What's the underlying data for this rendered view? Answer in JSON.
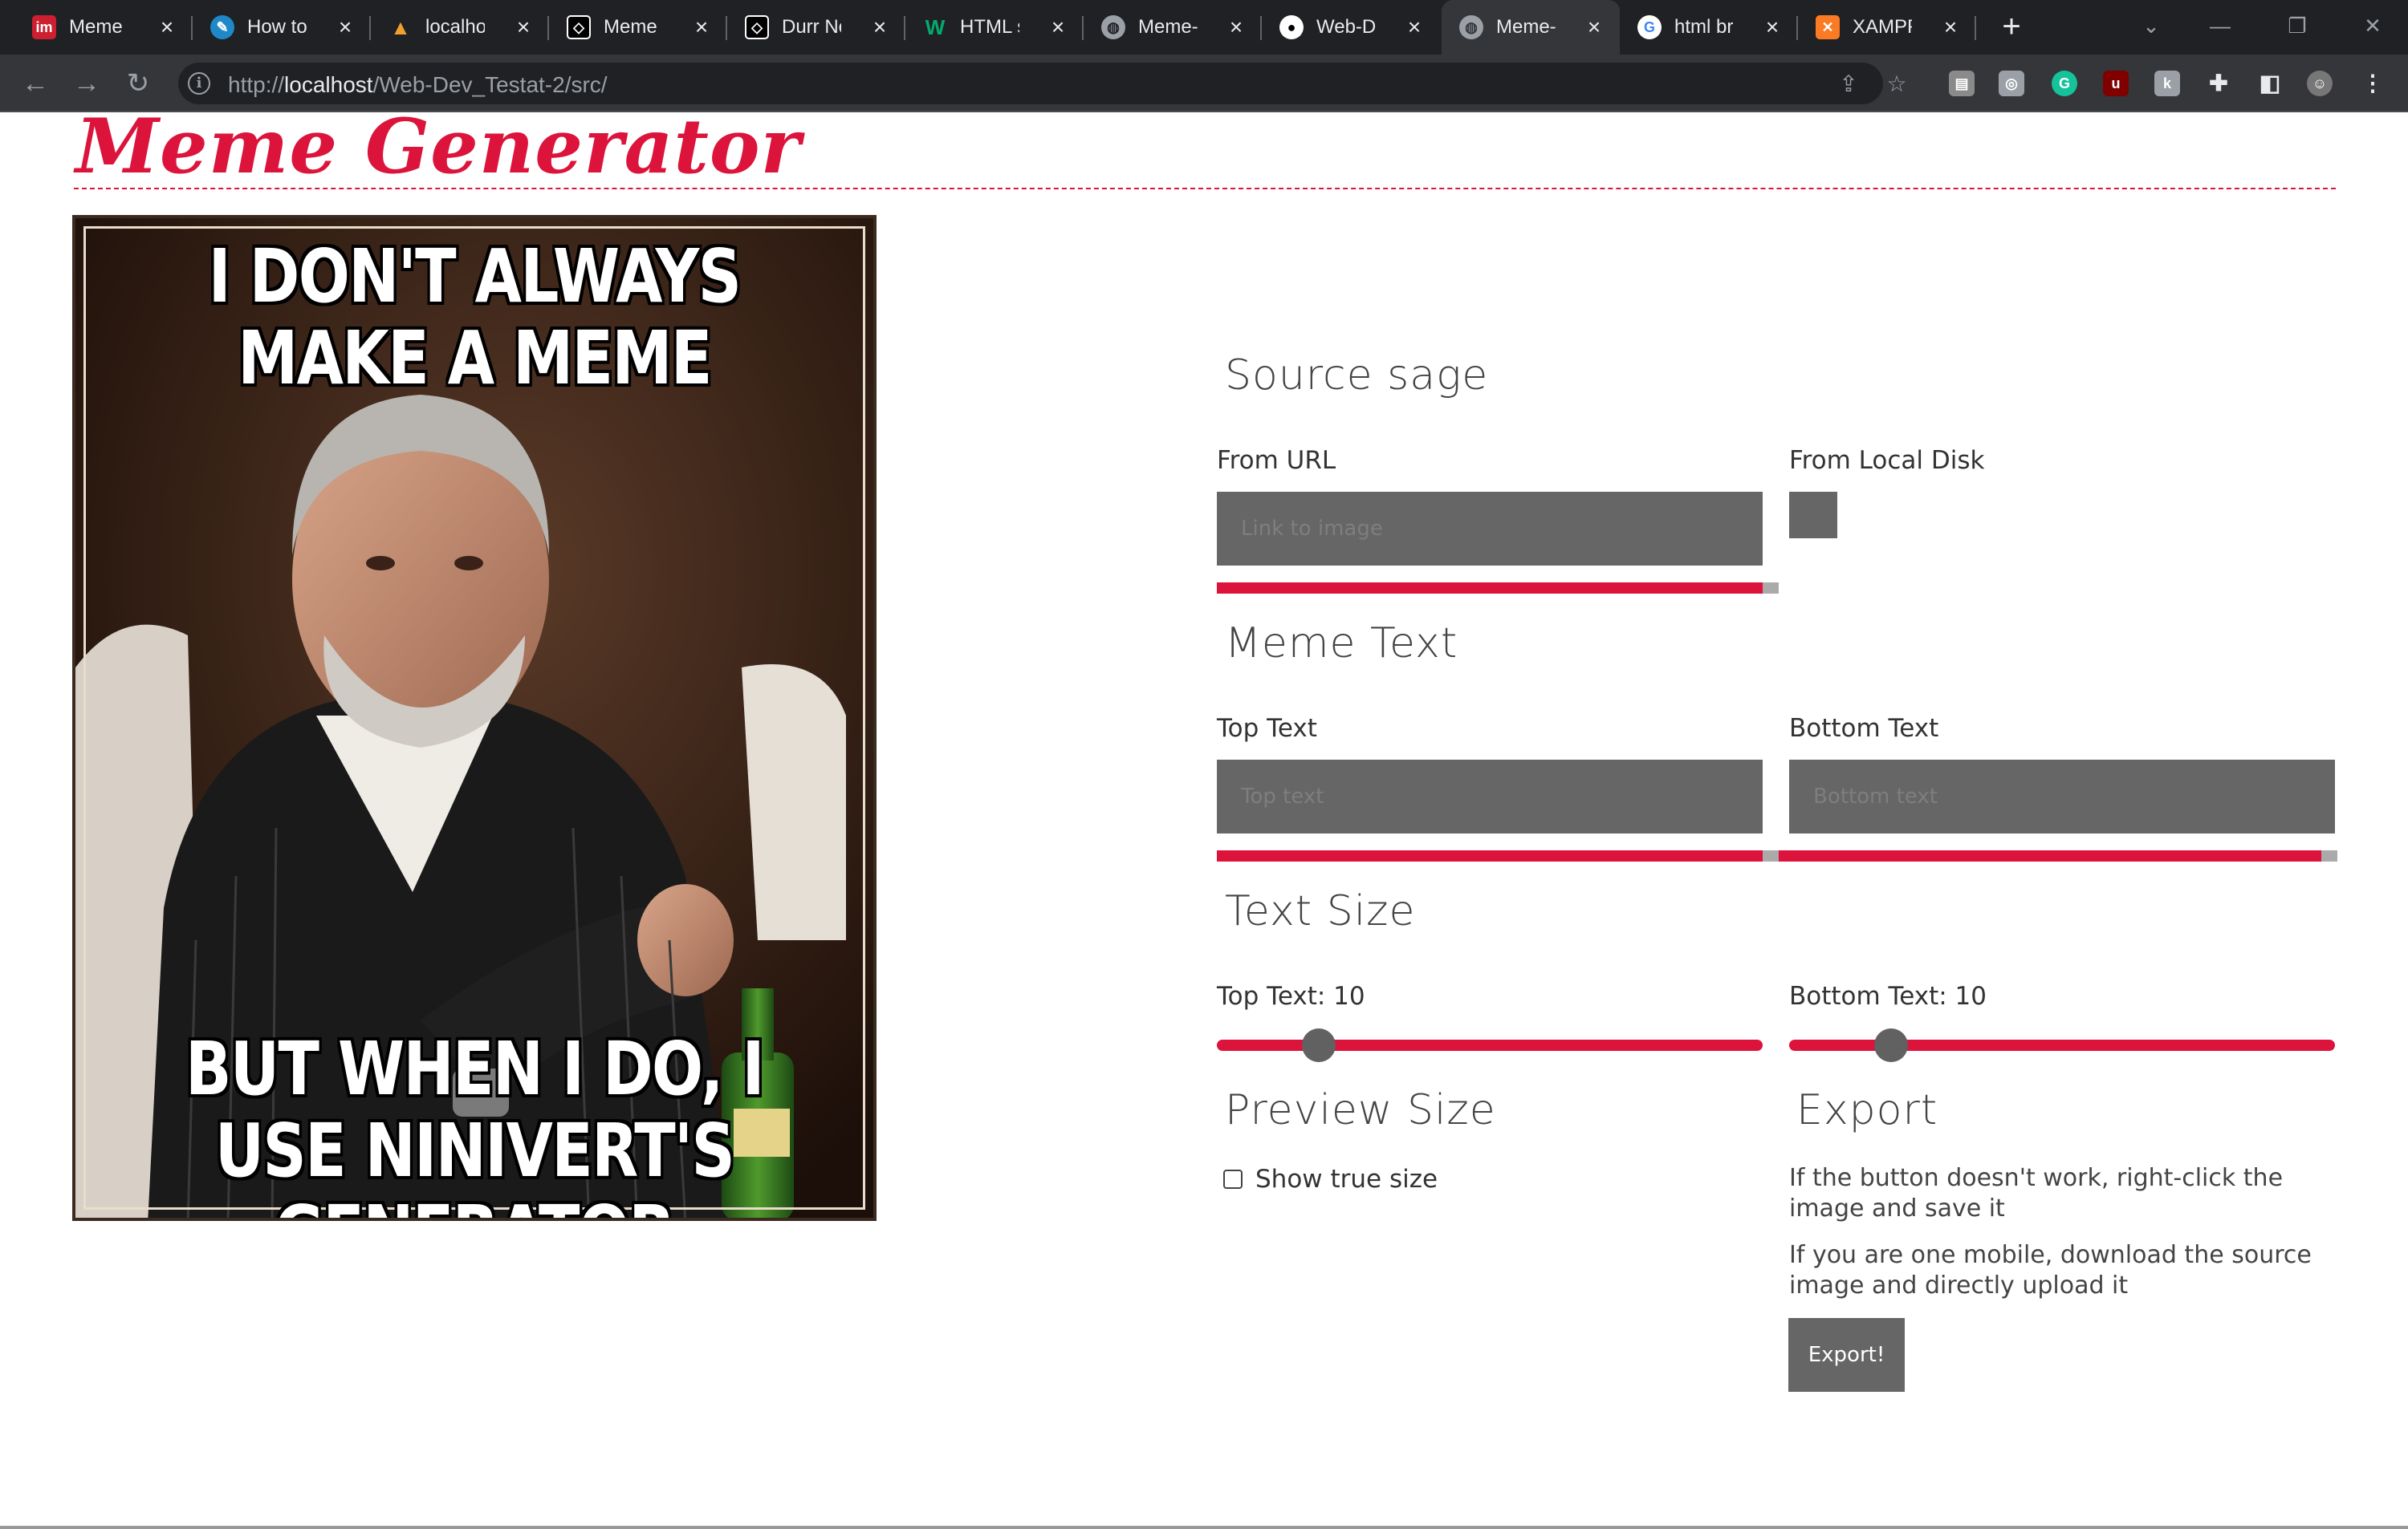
{
  "browser": {
    "tabs": [
      {
        "title": "Meme Generator",
        "icon": "imgflip-icon",
        "color": "#cc1f2f"
      },
      {
        "title": "How to use",
        "icon": "compass-icon",
        "color": "#1e88c8"
      },
      {
        "title": "localhost",
        "icon": "xampp-bars-icon",
        "color": "#f0a030"
      },
      {
        "title": "Meme Gen",
        "icon": "codepen-icon",
        "color": "#000000"
      },
      {
        "title": "Durr New",
        "icon": "codepen-icon",
        "color": "#000000"
      },
      {
        "title": "HTML scr",
        "icon": "w3-icon",
        "color": "#04aa6d"
      },
      {
        "title": "Meme-G",
        "icon": "globe-icon",
        "color": "#5f6368"
      },
      {
        "title": "Web-Dev",
        "icon": "github-icon",
        "color": "#000000"
      },
      {
        "title": "Meme-G",
        "icon": "globe-icon",
        "color": "#5f6368",
        "active": true
      },
      {
        "title": "html brea",
        "icon": "google-icon",
        "color": "#ffffff"
      },
      {
        "title": "XAMPP In",
        "icon": "xampp-icon",
        "color": "#fb7a24"
      }
    ],
    "new_tab": "+",
    "url_prefix": "http://",
    "url_host": "localhost",
    "url_path": "/Web-Dev_Testat-2/src/"
  },
  "page": {
    "title": "Meme Generator",
    "meme": {
      "top_caption": "I DON'T ALWAYS MAKE A MEME",
      "bottom_caption": "BUT WHEN I DO, I USE NINIVERT'S GENERATOR"
    },
    "source": {
      "heading": "Source sage",
      "url_label": "From URL",
      "url_placeholder": "Link to image",
      "disk_label": "From Local Disk"
    },
    "meme_text": {
      "heading": "Meme Text",
      "top_label": "Top Text",
      "top_placeholder": "Top text",
      "bottom_label": "Bottom Text",
      "bottom_placeholder": "Bottom text"
    },
    "text_size": {
      "heading": "Text Size",
      "top_label": "Top Text: 10",
      "bottom_label": "Bottom Text: 10",
      "top_value": 10,
      "bottom_value": 10
    },
    "preview": {
      "heading": "Preview Size",
      "checkbox_label": "Show true size",
      "checked": false
    },
    "export": {
      "heading": "Export",
      "note1": "If the button doesn't work, right-click the image and save it",
      "note2": "If you are one mobile, download the source image and directly upload it",
      "button": "Export!"
    },
    "accent_color": "#dc143c"
  }
}
